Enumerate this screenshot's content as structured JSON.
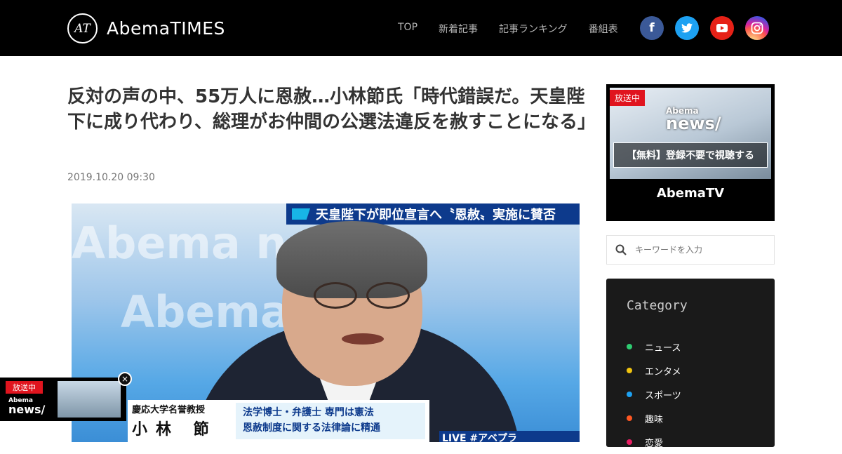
{
  "header": {
    "logo_mark": "AT",
    "logo_text": "AbemaTIMES",
    "nav": [
      "TOP",
      "新着記事",
      "記事ランキング",
      "番組表"
    ],
    "social": {
      "facebook": "f",
      "twitter": "🐦",
      "youtube": "▶",
      "instagram": "◎"
    }
  },
  "article": {
    "title": "反対の声の中、55万人に恩赦…小林節氏「時代錯誤だ。天皇陛下に成り代わり、総理がお仲間の公選法違反を赦すことになる」",
    "date": "2019.10.20 09:30",
    "hero": {
      "banner": "天皇陛下が即位宣言へ〝恩赦〟実施に賛否",
      "bg_text_1": "Abema news",
      "bg_text_2": "Abema TIME",
      "caption_title": "慶応大学名誉教授",
      "caption_name": "小林 節",
      "caption_line1": "法学博士・弁護士 専門は憲法",
      "caption_line2": "恩赦制度に関する法律論に精通",
      "live_badge": "LIVE #アベプラ"
    }
  },
  "mini_player": {
    "onair": "放送中",
    "brand_top": "Abema",
    "brand": "news/",
    "close": "×"
  },
  "sidebar": {
    "live_card": {
      "onair": "放送中",
      "brand_top": "Abema",
      "brand": "news/",
      "cta": "【無料】登録不要で視聴する",
      "abematv": "AbemaTV"
    },
    "search": {
      "placeholder": "キーワードを入力"
    },
    "category": {
      "title": "Category",
      "items": [
        {
          "label": "ニュース",
          "color": "#2ecc71"
        },
        {
          "label": "エンタメ",
          "color": "#f1c40f"
        },
        {
          "label": "スポーツ",
          "color": "#1da1f2"
        },
        {
          "label": "趣味",
          "color": "#ff5722"
        },
        {
          "label": "恋愛",
          "color": "#e91e63"
        }
      ]
    }
  }
}
